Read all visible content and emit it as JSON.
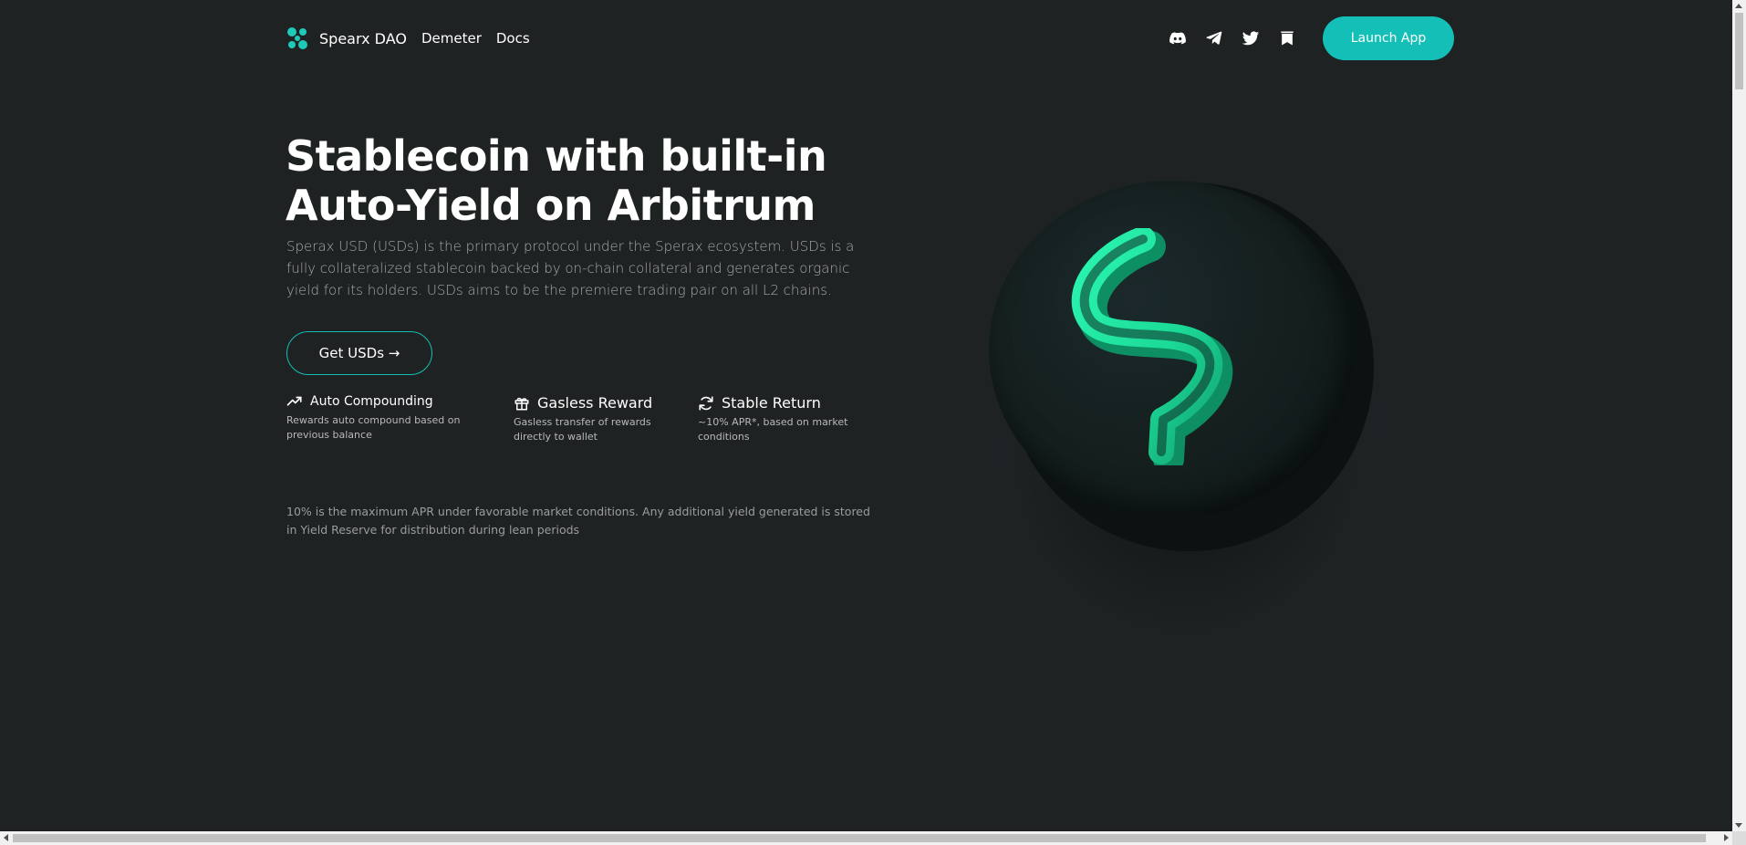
{
  "nav": {
    "brand_name": "Spearx DAO",
    "links": [
      "Demeter",
      "Docs"
    ],
    "socials": [
      "discord-icon",
      "telegram-icon",
      "twitter-icon",
      "medium-icon"
    ],
    "launch_label": "Launch App"
  },
  "hero": {
    "title_line1": "Stablecoin with built-in",
    "title_line2": "Auto-Yield on Arbitrum",
    "description": "Sperax USD (USDs) is the primary protocol under the Sperax ecosystem. USDs is a fully collateralized stablecoin backed by on-chain collateral and generates organic yield for its holders. USDs aims to be the premiere trading pair on all L2 chains.",
    "cta_label": "Get USDs →"
  },
  "features": [
    {
      "icon": "trending-up-icon",
      "title": "Auto Compounding",
      "desc_line1": "Rewards auto compound based on",
      "desc_line2": "previous balance"
    },
    {
      "icon": "gift-icon",
      "title": "Gasless Reward",
      "desc_line1": "Gasless transfer of rewards",
      "desc_line2": "directly to wallet"
    },
    {
      "icon": "refresh-icon",
      "title": "Stable Return",
      "desc_line1": "~10% APR*, based on market",
      "desc_line2": "conditions"
    }
  ],
  "footnote": "10% is the maximum APR under favorable market conditions. Any additional yield generated is stored in Yield Reserve for distribution during lean periods",
  "colors": {
    "background": "#1f2223",
    "accent": "#13bfb6",
    "logo_green": "#1ee3a2"
  }
}
